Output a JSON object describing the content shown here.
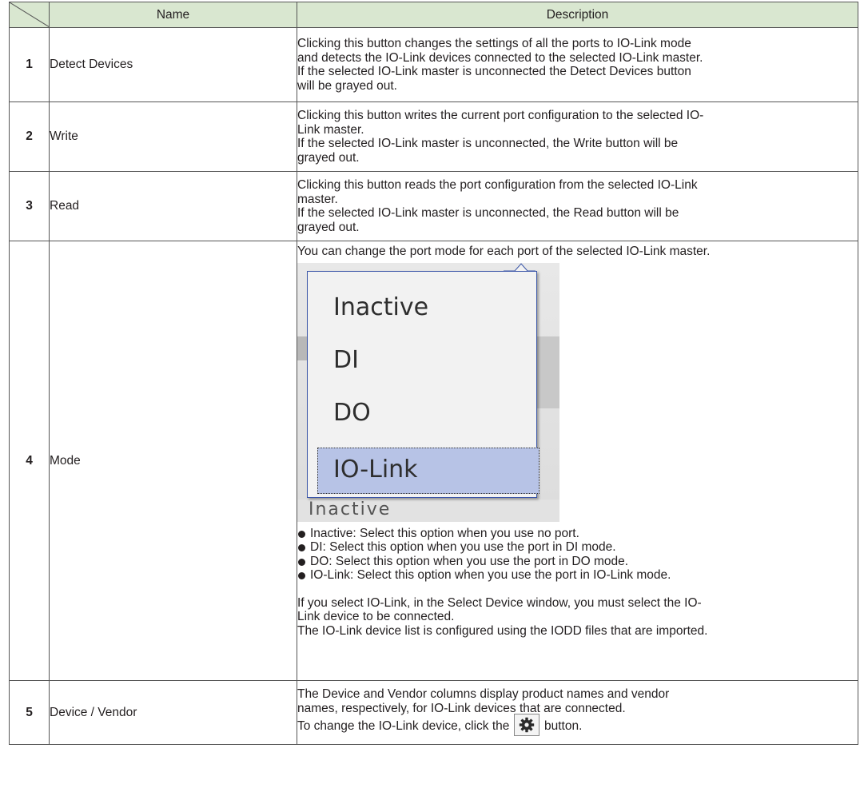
{
  "header": {
    "name": "Name",
    "description": "Description"
  },
  "rows": [
    {
      "number": "1",
      "name": "Detect Devices",
      "description": [
        "Clicking this button changes the settings of all the ports to IO-Link mode",
        "and detects the IO-Link devices connected to the selected IO-Link master.",
        "If the selected IO-Link master is unconnected the Detect Devices button",
        "will be grayed out."
      ]
    },
    {
      "number": "2",
      "name": "Write",
      "description": [
        "Clicking this button writes the current port configuration to the selected IO-",
        "Link master.",
        "If the selected IO-Link master is unconnected, the Write button will be",
        "grayed out."
      ]
    },
    {
      "number": "3",
      "name": "Read",
      "description": [
        "Clicking this button reads the port configuration from the selected IO-Link",
        "master.",
        "If the selected IO-Link master is unconnected, the Read button will be",
        "grayed out."
      ]
    },
    {
      "number": "4",
      "name": "Mode",
      "intro": "You can change the port mode for each port of the selected IO-Link master.",
      "dropdown": {
        "options": [
          "Inactive",
          "DI",
          "DO",
          "IO-Link"
        ],
        "selected": "IO-Link",
        "selected_color": "#b7c3e6",
        "cutoff_text": "Inactive"
      },
      "options_list": [
        "Inactive: Select this option when you use no port.",
        "DI: Select this option when you use the port in DI mode.",
        "DO: Select this option when you use the port in DO mode.",
        "IO-Link: Select this option when you use the port in IO-Link mode."
      ],
      "notes": [
        "If you select IO-Link, in the Select Device window, you must select the IO-",
        "Link device to be connected.",
        "The IO-Link device list is configured using the IODD files that are imported."
      ]
    },
    {
      "number": "5",
      "name": "Device / Vendor",
      "description": [
        "The Device and Vendor columns display product names and vendor",
        "names, respectively, for IO-Link devices that are connected."
      ],
      "change_before": "To change the IO-Link device, click the",
      "change_icon": "gear-icon",
      "change_after": "button."
    }
  ],
  "colors": {
    "header_bg": "#d9e7d0",
    "border": "#555555"
  }
}
